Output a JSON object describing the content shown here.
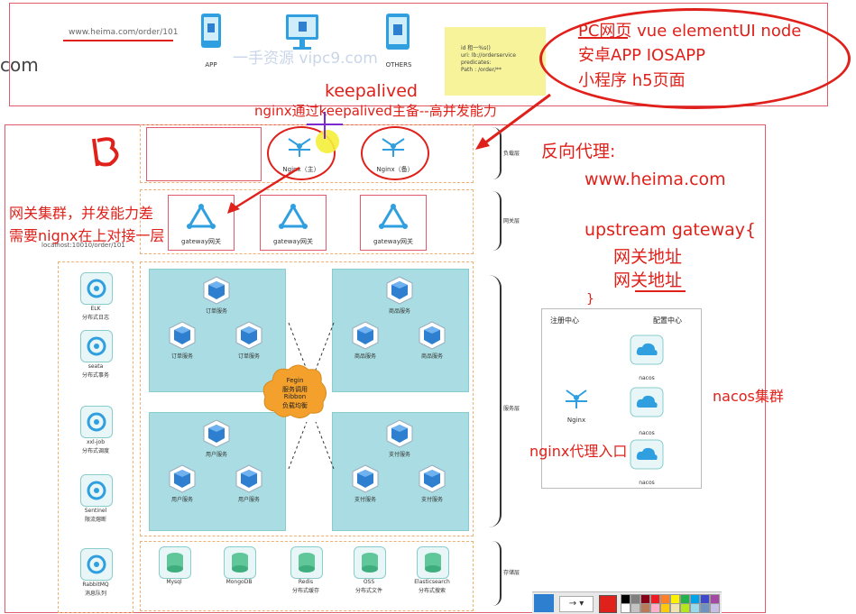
{
  "top": {
    "url": "www.heima.com/order/101",
    "app_label": "APP",
    "others_label": "OTHERS",
    "watermark": "一手资源  vipc9.com",
    "side_com": "com",
    "note_lines": [
      "id 租一%s()",
      "uri: lb://orderservice",
      "predicates:",
      "Path  : /order/**"
    ]
  },
  "clients": {
    "line1": "PC网页   vue  elementUI node",
    "line2": "安卓APP    IOSAPP",
    "line3": "小程序    h5页面"
  },
  "annotations": {
    "keepalived": "keepalived",
    "keepalived_note": "nginx通过keepalived主备--高并发能力",
    "gateway_cluster_1": "网关集群，并发能力差",
    "gateway_cluster_2": "需要nignx在上对接一层",
    "reverse_proxy": "反向代理:",
    "domain": "www.heima.com",
    "upstream": "upstream gateway{",
    "gw_addr1": "网关地址",
    "gw_addr2": "网关地址",
    "brace": "}",
    "nacos_cluster": "nacos集群",
    "nginx_entry": "nginx代理入口"
  },
  "tiers": {
    "nginx_main": "Nginx（主）",
    "nginx_backup": "Nginx（备）",
    "tier1": "负载层",
    "tier2": "网关层",
    "tier3": "服务层",
    "tier4": "存储层",
    "gateway": "gateway网关",
    "gateway_url": "localhost:10010/order/101"
  },
  "services": {
    "fegin": [
      "Fegin",
      "服务调用",
      "Ribbon",
      "负载均衡"
    ],
    "order": [
      "订单服务",
      "订单服务",
      "订单服务"
    ],
    "product": [
      "商品服务",
      "商品服务",
      "商品服务"
    ],
    "user": [
      "用户服务",
      "用户服务",
      "用户服务"
    ],
    "pay": [
      "支付服务",
      "支付服务",
      "支付服务"
    ]
  },
  "left_tools": [
    {
      "name": "ELK",
      "desc": "分布式日志"
    },
    {
      "name": "seata",
      "desc": "分布式事务"
    },
    {
      "name": "xxl-job",
      "desc": "分布式调度"
    },
    {
      "name": "Sentinel",
      "desc": "限流熔断"
    },
    {
      "name": "RabbitMQ",
      "desc": "消息队列"
    }
  ],
  "storage": [
    {
      "name": "Mysql",
      "desc": ""
    },
    {
      "name": "MongoDB",
      "desc": ""
    },
    {
      "name": "Redis",
      "desc": "分布式缓存"
    },
    {
      "name": "OSS",
      "desc": "分布式文件"
    },
    {
      "name": "Elasticsearch",
      "desc": "分布式搜索"
    }
  ],
  "nacos": {
    "registry": "注册中心",
    "config": "配置中心",
    "nginx": "Nginx",
    "nodes": [
      "nacos",
      "nacos",
      "nacos"
    ]
  },
  "palette": {
    "accent": "#e0201a",
    "service_bg": "#a9dde3",
    "cube": "#2f7fd0",
    "fegin": "#f3a02c"
  }
}
